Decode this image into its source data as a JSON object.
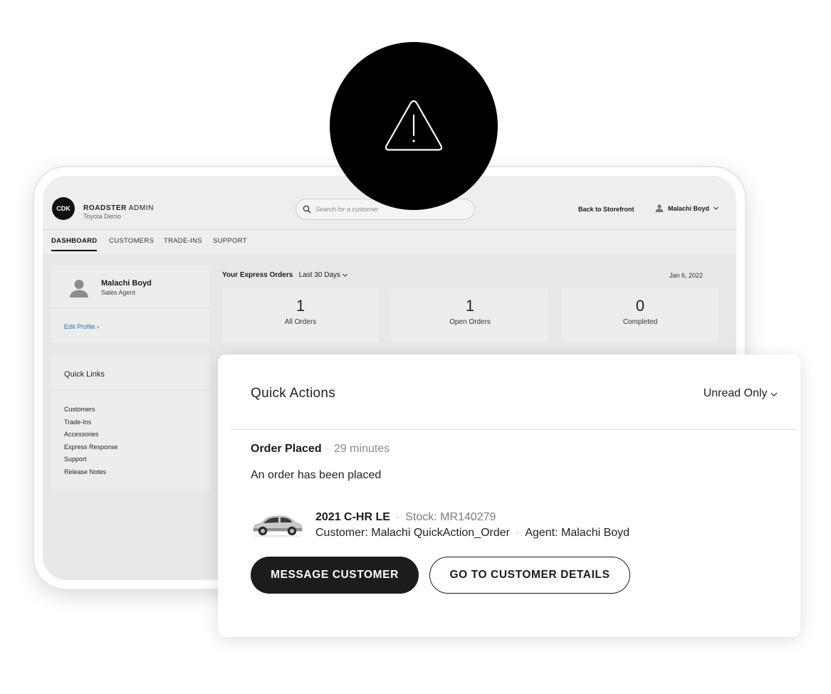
{
  "header": {
    "logo_text": "CDK",
    "brand_bold": "ROADSTER",
    "brand_light": "ADMIN",
    "dealer": "Toyota Demo",
    "search_placeholder": "Search for a customer",
    "back_link": "Back to Storefront",
    "user_name": "Malachi Boyd"
  },
  "tabs": [
    {
      "label": "DASHBOARD",
      "active": true
    },
    {
      "label": "CUSTOMERS",
      "active": false
    },
    {
      "label": "TRADE-INS",
      "active": false
    },
    {
      "label": "SUPPORT",
      "active": false
    }
  ],
  "profile": {
    "name": "Malachi Boyd",
    "role": "Sales Agent",
    "edit_link": "Edit Profile"
  },
  "quick_links": {
    "title": "Quick Links",
    "items": [
      "Customers",
      "Trade-Ins",
      "Accessories",
      "Express Response",
      "Support",
      "Release Notes"
    ]
  },
  "orders": {
    "title": "Your Express Orders",
    "range": "Last 30 Days",
    "date": "Jan 6, 2022",
    "stats": [
      {
        "value": "1",
        "label": "All Orders"
      },
      {
        "value": "1",
        "label": "Open Orders"
      },
      {
        "value": "0",
        "label": "Completed"
      }
    ]
  },
  "quick_actions": {
    "title": "Quick Actions",
    "filter": "Unread Only",
    "event": "Order Placed",
    "event_time": "29 minutes",
    "message": "An order has been placed",
    "vehicle": "2021 C-HR LE",
    "stock_label": "Stock:",
    "stock_number": "MR140279",
    "customer": "Customer: Malachi QuickAction_Order",
    "agent": "Agent: Malachi Boyd",
    "primary_button": "MESSAGE CUSTOMER",
    "secondary_button": "GO TO CUSTOMER DETAILS"
  },
  "icons": {
    "alert": "warning-triangle-icon",
    "search": "search-icon",
    "user": "user-icon",
    "car": "car-icon"
  },
  "colors": {
    "link": "#2f6fb5",
    "primary_button": "#1c1c1c",
    "warning_circle": "#000000"
  }
}
